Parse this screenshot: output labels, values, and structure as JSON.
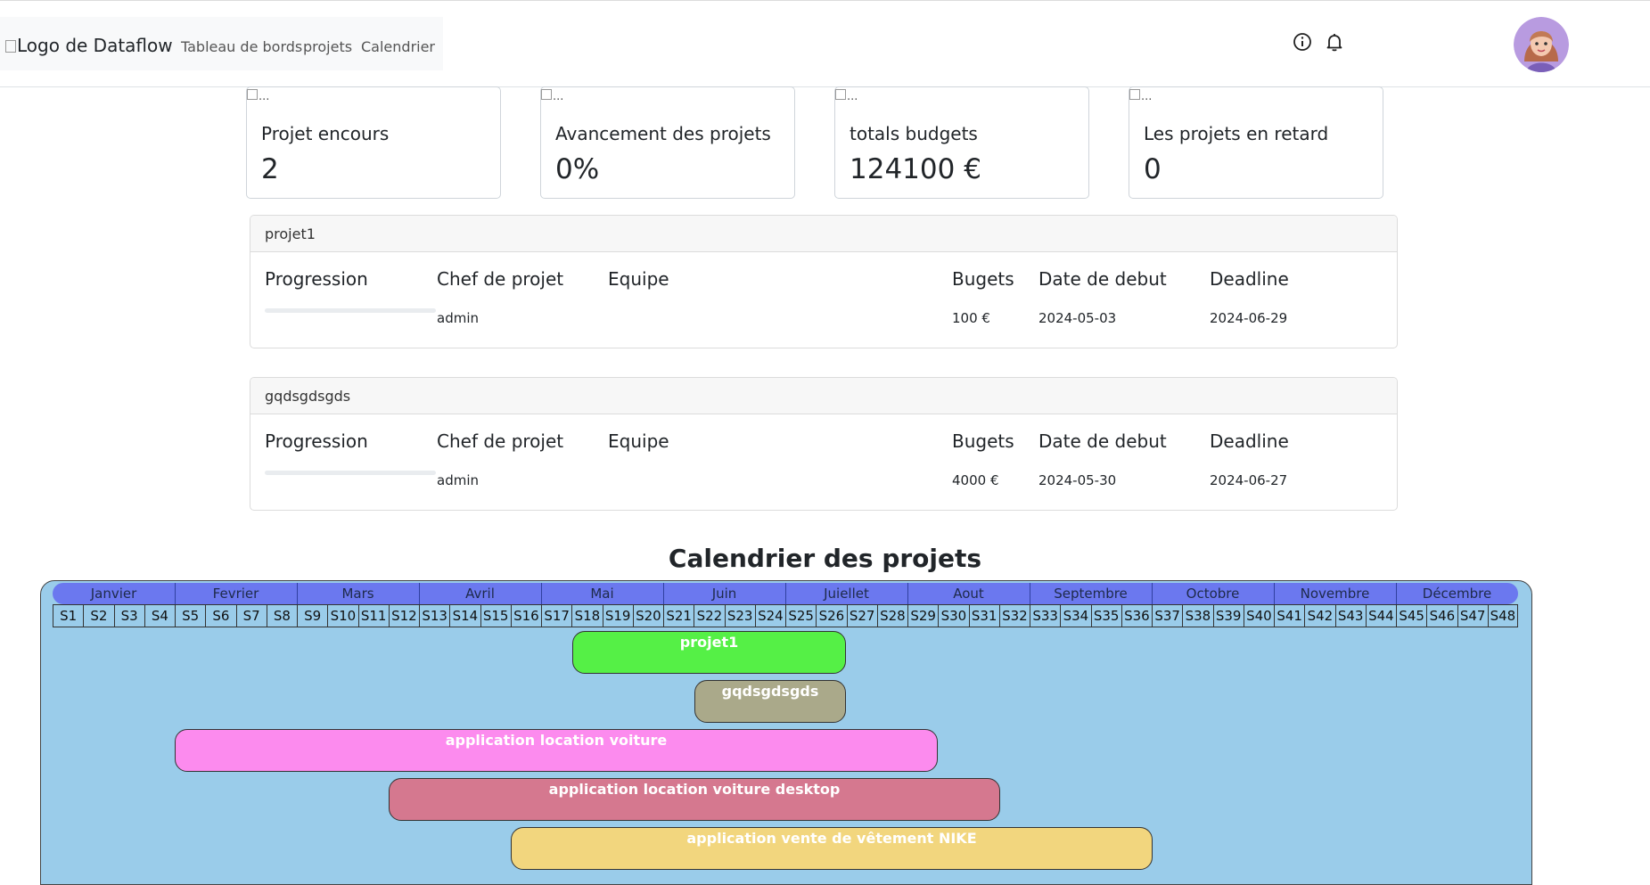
{
  "header": {
    "logo_alt": "Logo de Dataflow",
    "nav": [
      "Tableau de bords",
      "projets",
      "Calendrier"
    ]
  },
  "stats": [
    {
      "title": "Projet encours",
      "value": "2"
    },
    {
      "title": "Avancement des projets",
      "value": "0%"
    },
    {
      "title": "totals budgets",
      "value": "124100 €"
    },
    {
      "title": "Les projets en retard",
      "value": "0"
    }
  ],
  "stat_image_alt": "...",
  "columns": {
    "progression": "Progression",
    "chef": "Chef de projet",
    "equipe": "Equipe",
    "budgets": "Bugets",
    "debut": "Date de debut",
    "deadline": "Deadline"
  },
  "projects": [
    {
      "name": "projet1",
      "chef": "admin",
      "budget": "100 €",
      "debut": "2024-05-03",
      "deadline": "2024-06-29",
      "progress": 0
    },
    {
      "name": "gqdsgdsgds",
      "chef": "admin",
      "budget": "4000 €",
      "debut": "2024-05-30",
      "deadline": "2024-06-27",
      "progress": 0
    }
  ],
  "calendar": {
    "title": "Calendrier des projets",
    "months": [
      "Janvier",
      "Fevrier",
      "Mars",
      "Avril",
      "Mai",
      "Juin",
      "Juiellet",
      "Aout",
      "Septembre",
      "Octobre",
      "Novembre",
      "Décembre"
    ],
    "weeks": [
      "S1",
      "S2",
      "S3",
      "S4",
      "S5",
      "S6",
      "S7",
      "S8",
      "S9",
      "S10",
      "S11",
      "S12",
      "S13",
      "S14",
      "S15",
      "S16",
      "S17",
      "S18",
      "S19",
      "S20",
      "S21",
      "S22",
      "S23",
      "S24",
      "S25",
      "S26",
      "S27",
      "S28",
      "S29",
      "S30",
      "S31",
      "S32",
      "S33",
      "S34",
      "S35",
      "S36",
      "S37",
      "S38",
      "S39",
      "S40",
      "S41",
      "S42",
      "S43",
      "S44",
      "S45",
      "S46",
      "S47",
      "S48"
    ],
    "bars": [
      {
        "label": "projet1",
        "color": "#55f046"
      },
      {
        "label": "gqdsgdsgds",
        "color": "#aaa98a"
      },
      {
        "label": "application location voiture",
        "color": "#fc8bee"
      },
      {
        "label": "application location voiture desktop",
        "color": "#d5788f"
      },
      {
        "label": "application vente de vêtement NIKE",
        "color": "#f2d67e"
      }
    ]
  },
  "colors": {
    "calendar_bg": "#9ACCEA",
    "month_band": "#6b78ef"
  }
}
